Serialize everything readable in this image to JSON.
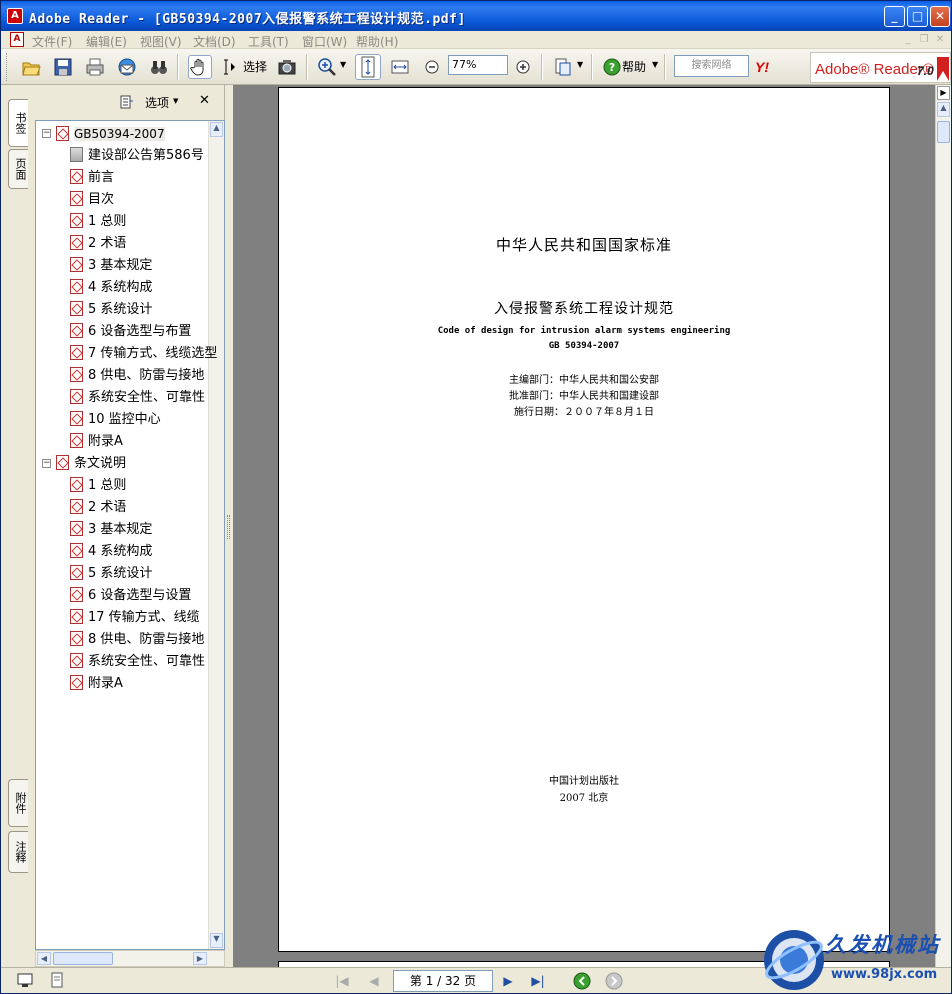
{
  "window": {
    "title": "Adobe Reader - [GB50394-2007入侵报警系统工程设计规范.pdf]",
    "minimize": "_",
    "maximize": "□",
    "close": "✕"
  },
  "menu": {
    "items": [
      "文件(F)",
      "编辑(E)",
      "视图(V)",
      "文档(D)",
      "工具(T)",
      "窗口(W)",
      "帮助(H)"
    ]
  },
  "toolbar": {
    "select_label": "选择",
    "zoom_value": "77%",
    "help_label": "帮助",
    "search_placeholder": "搜索网络",
    "yahoo_label": "Y!"
  },
  "brand": {
    "name": "Adobe® Reader®",
    "version": "7.0"
  },
  "side_tabs": {
    "bookmarks": "书签",
    "pages": "页面",
    "attachments": "附件",
    "comments": "注释"
  },
  "nav_panel": {
    "options_label": "选项",
    "close_label": "✕",
    "tree": [
      {
        "label": "GB50394-2007",
        "level": 0,
        "icon": "pdf-bookmark-icon",
        "expander": "⊟"
      },
      {
        "label": "建设部公告第586号",
        "level": 1,
        "icon": "page-icon"
      },
      {
        "label": "前言",
        "level": 1,
        "icon": "pdf-bookmark-icon"
      },
      {
        "label": "目次",
        "level": 1,
        "icon": "pdf-bookmark-icon"
      },
      {
        "label": "1 总则",
        "level": 1,
        "icon": "pdf-bookmark-icon"
      },
      {
        "label": "2 术语",
        "level": 1,
        "icon": "pdf-bookmark-icon"
      },
      {
        "label": "3 基本规定",
        "level": 1,
        "icon": "pdf-bookmark-icon"
      },
      {
        "label": "4 系统构成",
        "level": 1,
        "icon": "pdf-bookmark-icon"
      },
      {
        "label": "5 系统设计",
        "level": 1,
        "icon": "pdf-bookmark-icon"
      },
      {
        "label": "6 设备选型与布置",
        "level": 1,
        "icon": "pdf-bookmark-icon"
      },
      {
        "label": "7 传输方式、线缆选型",
        "level": 1,
        "icon": "pdf-bookmark-icon"
      },
      {
        "label": "8 供电、防雷与接地",
        "level": 1,
        "icon": "pdf-bookmark-icon"
      },
      {
        "label": "系统安全性、可靠性",
        "level": 1,
        "icon": "pdf-bookmark-icon"
      },
      {
        "label": "10 监控中心",
        "level": 1,
        "icon": "pdf-bookmark-icon"
      },
      {
        "label": "附录A",
        "level": 1,
        "icon": "pdf-bookmark-icon"
      },
      {
        "label": "条文说明",
        "level": 0,
        "icon": "pdf-bookmark-icon",
        "expander": "⊟"
      },
      {
        "label": "1 总则",
        "level": 1,
        "icon": "pdf-bookmark-icon"
      },
      {
        "label": "2 术语",
        "level": 1,
        "icon": "pdf-bookmark-icon"
      },
      {
        "label": "3 基本规定",
        "level": 1,
        "icon": "pdf-bookmark-icon"
      },
      {
        "label": "4 系统构成",
        "level": 1,
        "icon": "pdf-bookmark-icon"
      },
      {
        "label": "5 系统设计",
        "level": 1,
        "icon": "pdf-bookmark-icon"
      },
      {
        "label": "6 设备选型与设置",
        "level": 1,
        "icon": "pdf-bookmark-icon"
      },
      {
        "label": "17 传输方式、线缆",
        "level": 1,
        "icon": "pdf-bookmark-icon"
      },
      {
        "label": "8 供电、防雷与接地",
        "level": 1,
        "icon": "pdf-bookmark-icon"
      },
      {
        "label": "系统安全性、可靠性",
        "level": 1,
        "icon": "pdf-bookmark-icon"
      },
      {
        "label": "附录A",
        "level": 1,
        "icon": "pdf-bookmark-icon"
      }
    ]
  },
  "document": {
    "heading": "中华人民共和国国家标准",
    "title_cn": "入侵报警系统工程设计规范",
    "title_en": "Code of design for intrusion alarm systems engineering",
    "code": "GB 50394-2007",
    "editor": "主编部门：中华人民共和国公安部",
    "approver": "批准部门：中华人民共和国建设部",
    "effective": "施行日期：２００７年８月１日",
    "publisher": "中国计划出版社",
    "place": "2007 北京"
  },
  "status": {
    "page_display": "第 1 / 32 页"
  },
  "watermark": {
    "name": "久发机械站",
    "url": "www.98jx.com"
  },
  "colors": {
    "titlebar": "#0a5ce5",
    "chrome": "#ece9d8",
    "doc_background": "#808080",
    "brand_red": "#d21f1f"
  }
}
